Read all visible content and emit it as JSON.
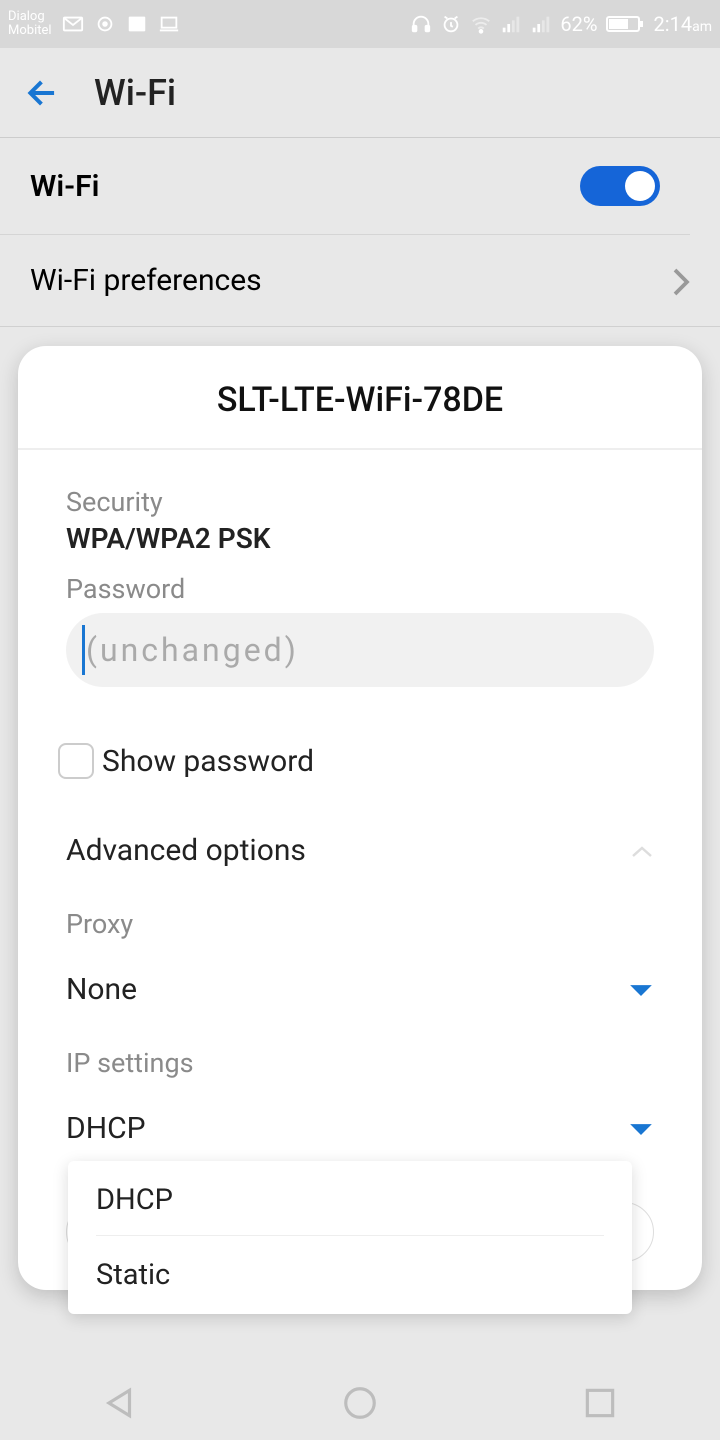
{
  "status": {
    "carrier_line1": "Dialog",
    "carrier_line2": "Mobitel",
    "battery": "62%",
    "time": "2:14",
    "time_suffix": "am"
  },
  "appbar": {
    "title": "Wi-Fi"
  },
  "rows": {
    "wifi_label": "Wi-Fi",
    "prefs_label": "Wi-Fi preferences"
  },
  "dialog": {
    "title": "SLT-LTE-WiFi-78DE",
    "security_label": "Security",
    "security_value": "WPA/WPA2 PSK",
    "password_label": "Password",
    "password_placeholder": "(unchanged)",
    "show_password": "Show password",
    "advanced": "Advanced options",
    "proxy_label": "Proxy",
    "proxy_value": "None",
    "ip_label": "IP settings",
    "ip_value": "DHCP"
  },
  "dropdown": {
    "option1": "DHCP",
    "option2": "Static"
  }
}
